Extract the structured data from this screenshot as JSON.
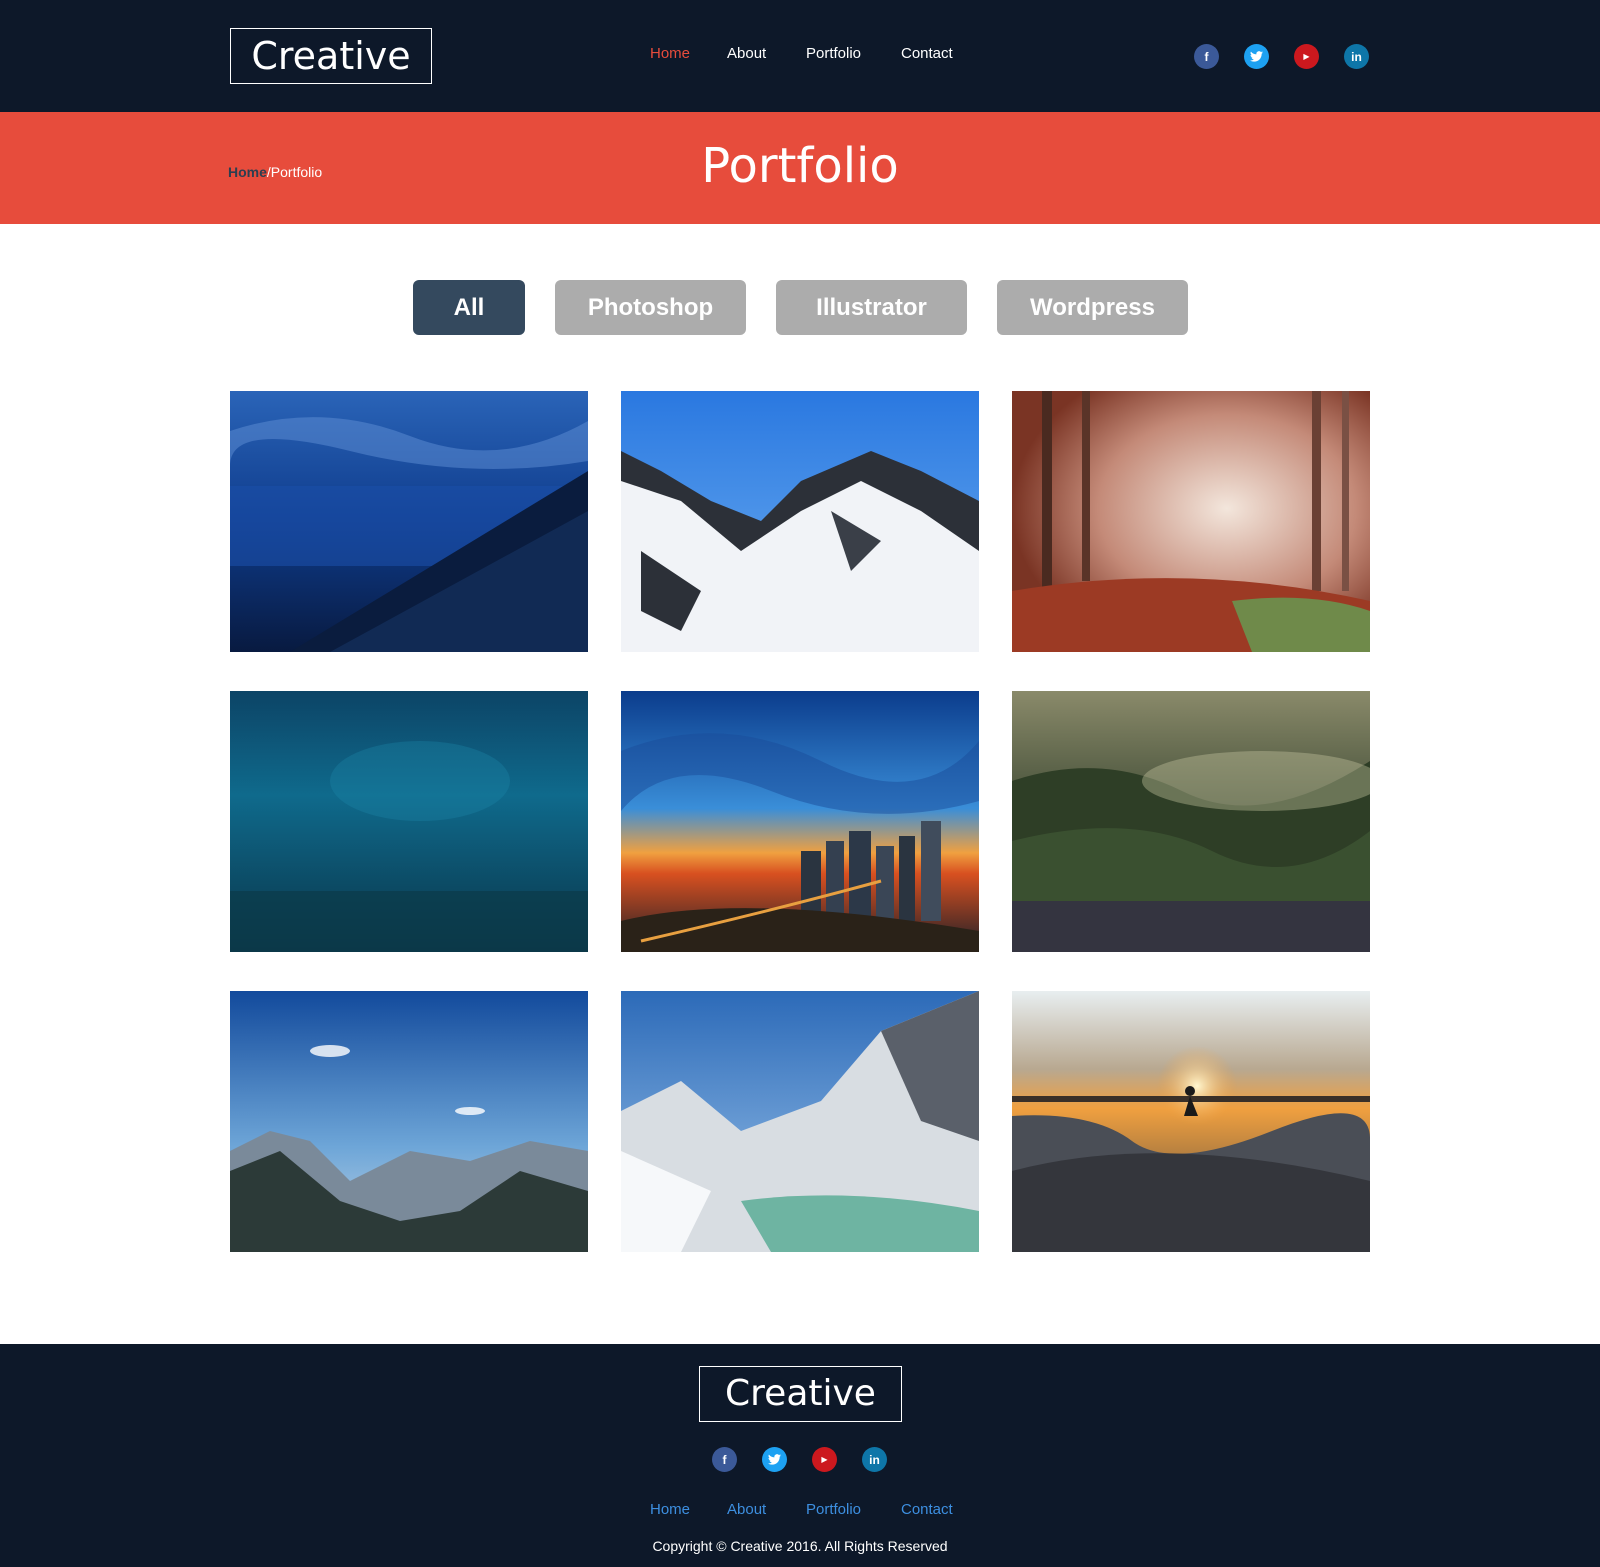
{
  "header": {
    "logo": "Creative",
    "nav": [
      "Home",
      "About",
      "Portfolio",
      "Contact"
    ],
    "active_nav": "Home",
    "social": [
      "facebook-icon",
      "twitter-icon",
      "youtube-icon",
      "linkedin-icon"
    ]
  },
  "banner": {
    "breadcrumb_home": "Home",
    "breadcrumb_sep": "/",
    "breadcrumb_current": "Portfolio",
    "title": "Portfolio"
  },
  "filters": [
    "All",
    "Photoshop",
    "Illustrator",
    "Wordpress"
  ],
  "active_filter": "All",
  "gallery": [
    "night-beach-photo",
    "snowy-mountain-photo",
    "autumn-forest-photo",
    "underwater-photo",
    "city-sunset-photo",
    "misty-forest-photo",
    "mountain-valley-photo",
    "glacier-lake-photo",
    "skatepark-sunset-photo"
  ],
  "footer": {
    "logo": "Creative",
    "nav": [
      "Home",
      "About",
      "Portfolio",
      "Contact"
    ],
    "copyright": "Copyright © Creative 2016. All Rights Reserved"
  },
  "colors": {
    "dark_navy": "#0d1829",
    "accent_red": "#e74c3c",
    "filter_active": "#34495e",
    "filter_inactive": "#acacac",
    "footer_link": "#3d8fe0"
  }
}
